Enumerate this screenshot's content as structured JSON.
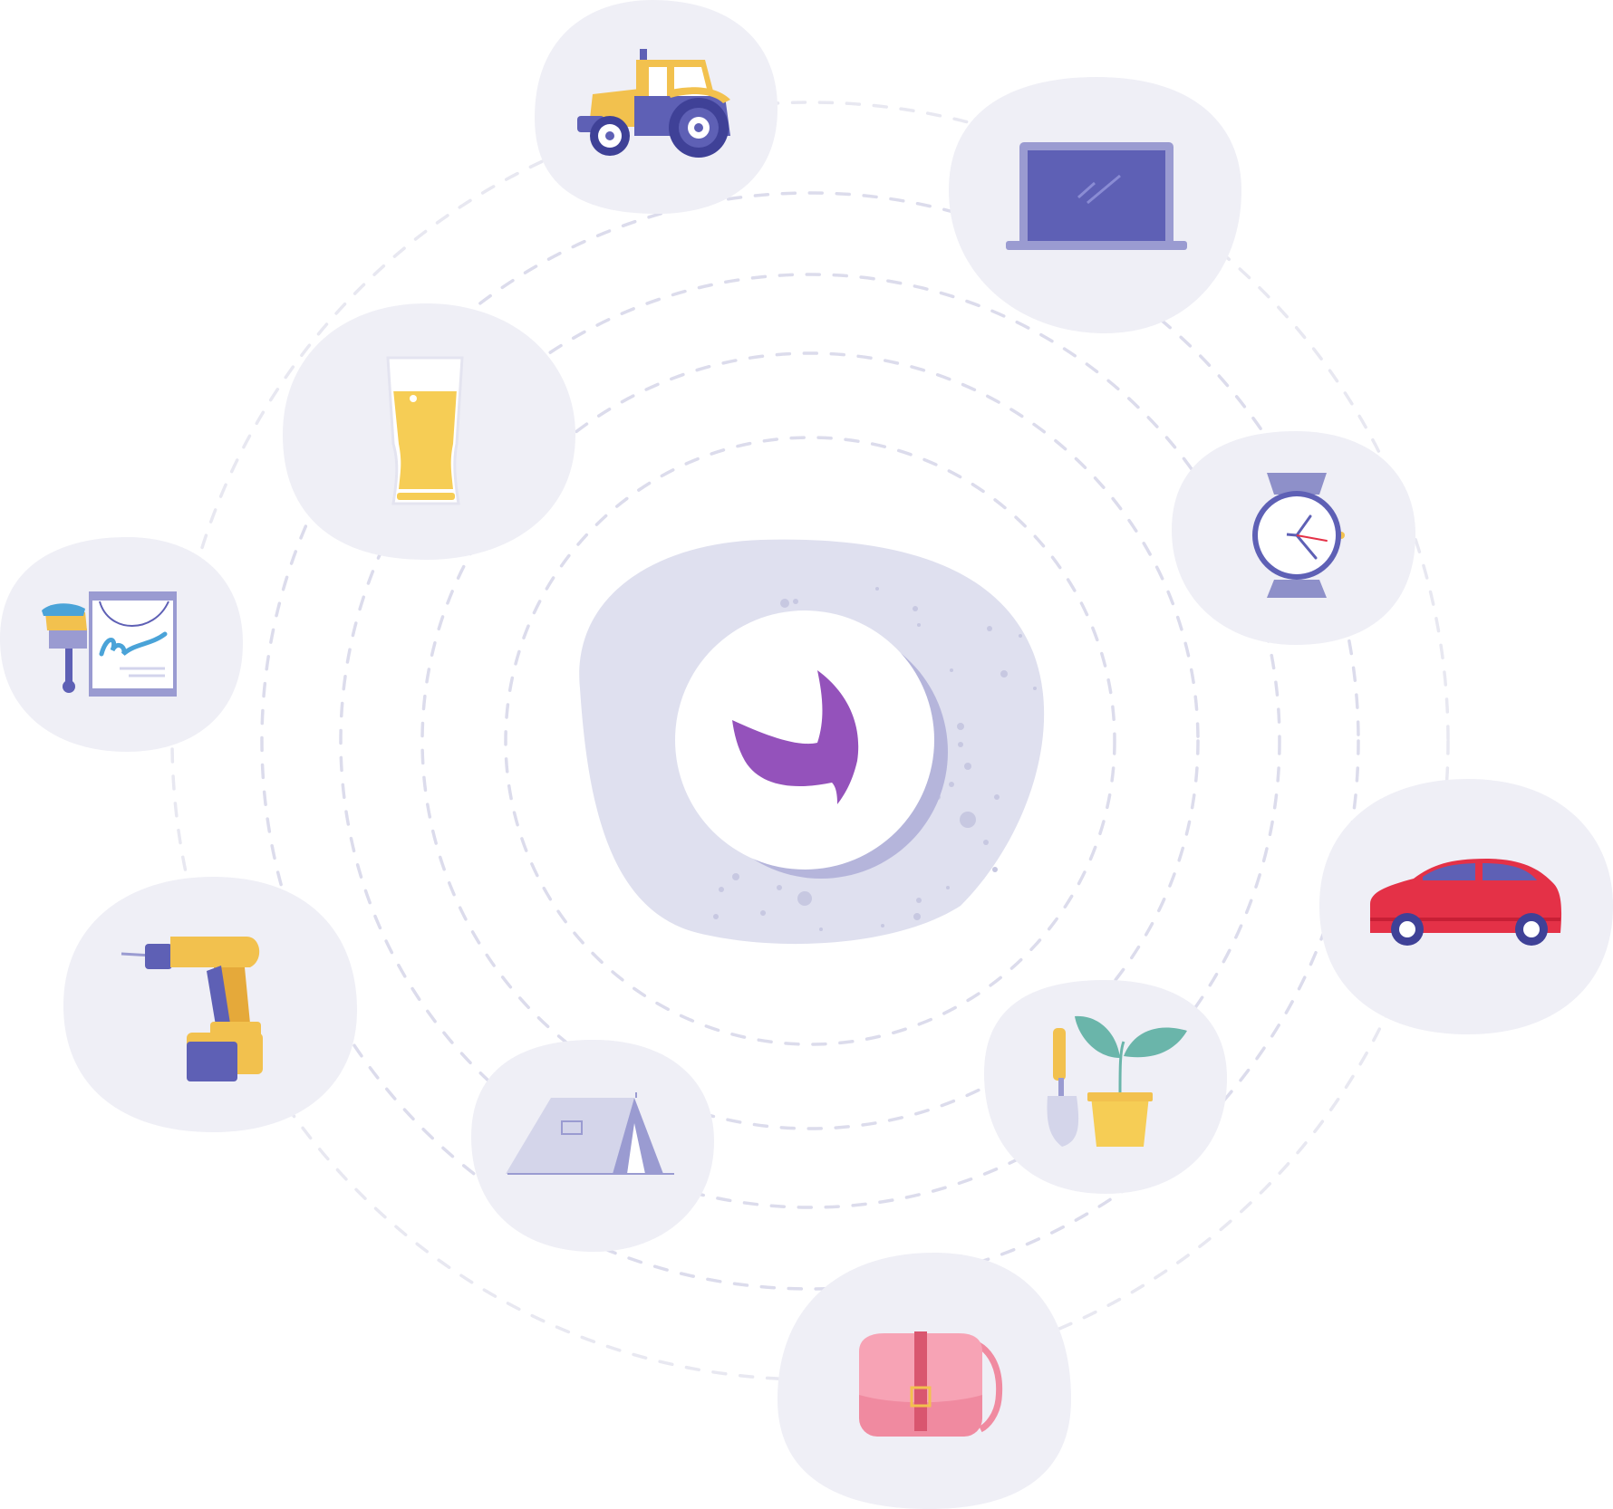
{
  "colors": {
    "background": "#ffffff",
    "orbit": "#dcdcec",
    "orbit_outer": "#e6e6f0",
    "bubble": "#efeff6",
    "center_blob": "#dfe0ef",
    "center_speckle": "#c7c8e1",
    "center_shadow": "#b5b5db",
    "logo_circle": "#ffffff",
    "logo_mark": "#9452bb",
    "purple": "#5e60b5",
    "purple_light": "#9a9bd1",
    "yellow": "#f2c14e",
    "yellow_dark": "#e5a93a",
    "beer": "#f6cd55",
    "foam": "#ffffff",
    "pink": "#f08aa0",
    "pink_dark": "#d9566f",
    "red_car": "#e43147",
    "teal": "#6ab5aa",
    "blue_paint": "#4aa3d8"
  },
  "center": {
    "name": "center-logo",
    "mark": "leaf-checkmark"
  },
  "items": [
    {
      "name": "tractor",
      "icon": "tractor-icon"
    },
    {
      "name": "laptop",
      "icon": "laptop-icon"
    },
    {
      "name": "beer-glass",
      "icon": "beer-glass-icon"
    },
    {
      "name": "wristwatch",
      "icon": "wristwatch-icon"
    },
    {
      "name": "paint-can",
      "icon": "paint-can-icon"
    },
    {
      "name": "car",
      "icon": "car-icon"
    },
    {
      "name": "power-drill",
      "icon": "power-drill-icon"
    },
    {
      "name": "plant-and-trowel",
      "icon": "plant-pot-icon"
    },
    {
      "name": "tent",
      "icon": "tent-icon"
    },
    {
      "name": "handbag",
      "icon": "handbag-icon"
    }
  ]
}
